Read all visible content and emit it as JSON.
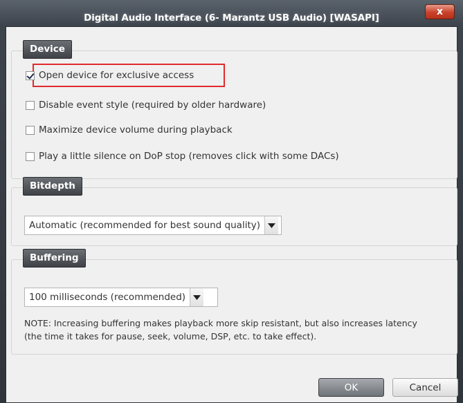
{
  "window": {
    "title": "Digital Audio Interface (6- Marantz USB Audio) [WASAPI]",
    "close_glyph": "x"
  },
  "device": {
    "title": "Device",
    "options": [
      {
        "label": "Open device for exclusive access",
        "checked": true
      },
      {
        "label": "Disable event style (required by older hardware)",
        "checked": false
      },
      {
        "label": "Maximize device volume during playback",
        "checked": false
      },
      {
        "label": "Play a little silence on DoP stop (removes click with some DACs)",
        "checked": false
      }
    ]
  },
  "bitdepth": {
    "title": "Bitdepth",
    "selected": "Automatic (recommended for best sound quality)"
  },
  "buffering": {
    "title": "Buffering",
    "selected": "100 milliseconds (recommended)",
    "note_line1": "NOTE: Increasing buffering makes playback more skip resistant, but also increases latency",
    "note_line2": "(the time it takes for pause, seek, volume, DSP, etc. to take effect)."
  },
  "buttons": {
    "ok": "OK",
    "cancel": "Cancel"
  }
}
